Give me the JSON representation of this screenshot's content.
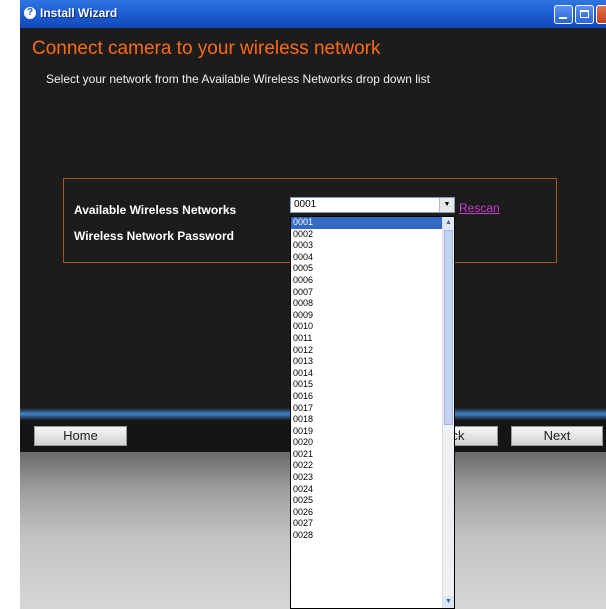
{
  "window": {
    "title": "Install Wizard"
  },
  "page": {
    "heading": "Connect camera to your wireless network",
    "subtext": "Select your network from the Available Wireless Networks drop down list"
  },
  "form": {
    "networks_label": "Available Wireless Networks",
    "password_label": "Wireless Network Password",
    "selected_network": "0001",
    "rescan_label": "Rescan"
  },
  "dropdown": {
    "options": [
      "0001",
      "0002",
      "0003",
      "0004",
      "0005",
      "0006",
      "0007",
      "0008",
      "0009",
      "0010",
      "0011",
      "0012",
      "0013",
      "0014",
      "0015",
      "0016",
      "0017",
      "0018",
      "0019",
      "0020",
      "0021",
      "0022",
      "0023",
      "0024",
      "0025",
      "0026",
      "0027",
      "0028"
    ]
  },
  "nav": {
    "home_label": "Home",
    "back_label": "ck",
    "next_label": "Next"
  },
  "colors": {
    "accent": "#ff6a10",
    "link": "#c83cc8",
    "selection": "#316ac5"
  }
}
